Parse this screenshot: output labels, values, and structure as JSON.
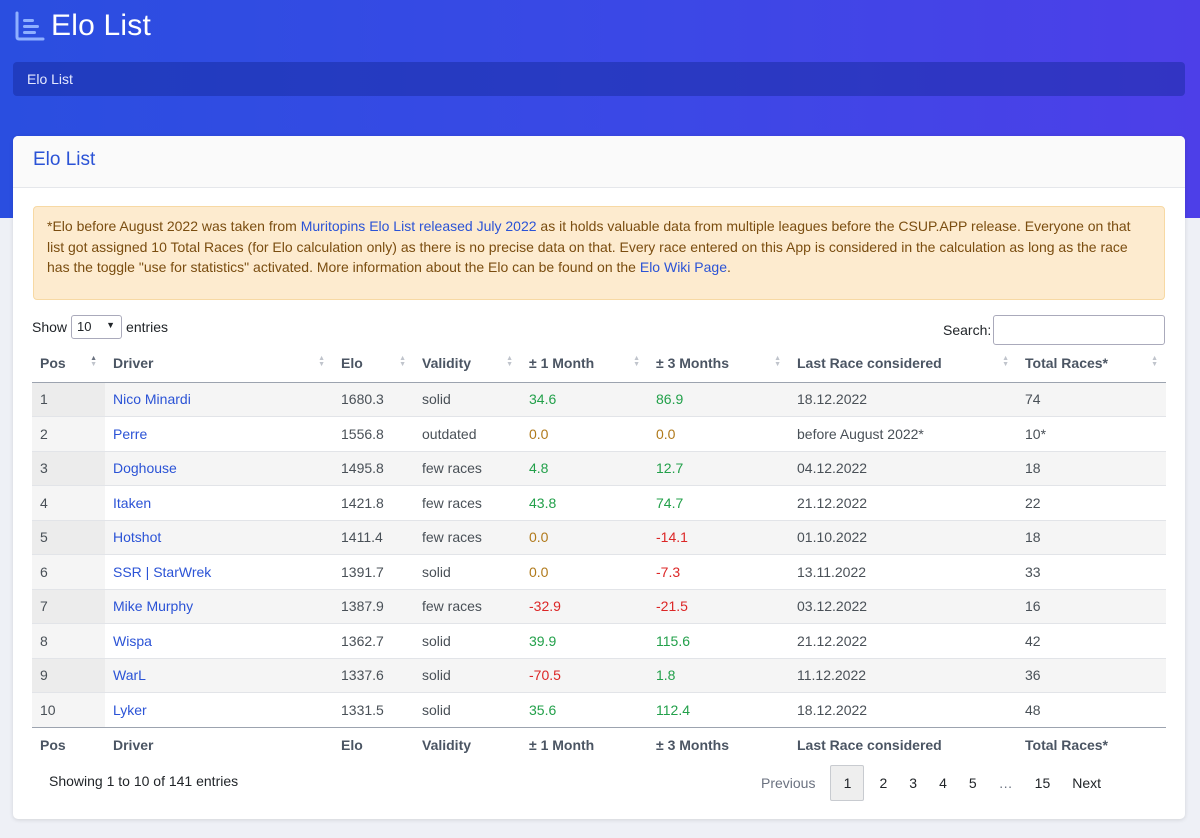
{
  "app": {
    "title": "Elo List",
    "breadcrumb": "Elo List"
  },
  "card": {
    "title": "Elo List"
  },
  "notice": {
    "text_1": "*Elo before August 2022 was taken from ",
    "link_1": "Muritopins Elo List released July 2022",
    "text_2": " as it holds valuable data from multiple leagues before the CSUP.APP release. Everyone on that list got assigned 10 Total Races (for Elo calculation only) as there is no precise data on that. Every race entered on this App is considered in the calculation as long as the race has the toggle \"use for statistics\" activated. More information about the Elo can be found on the ",
    "link_2": "Elo Wiki Page",
    "text_3": "."
  },
  "length_control": {
    "show_label": "Show",
    "value": "10",
    "entries_label": "entries"
  },
  "search": {
    "label": "Search:",
    "value": ""
  },
  "table": {
    "columns": [
      "Pos",
      "Driver",
      "Elo",
      "Validity",
      "± 1 Month",
      "± 3 Months",
      "Last Race considered",
      "Total Races*"
    ],
    "rows": [
      [
        "1",
        "Nico Minardi",
        "1680.3",
        "solid",
        "34.6",
        "86.9",
        "18.12.2022",
        "74"
      ],
      [
        "2",
        "Perre",
        "1556.8",
        "outdated",
        "0.0",
        "0.0",
        "before August 2022*",
        "10*"
      ],
      [
        "3",
        "Doghouse",
        "1495.8",
        "few races",
        "4.8",
        "12.7",
        "04.12.2022",
        "18"
      ],
      [
        "4",
        "Itaken",
        "1421.8",
        "few races",
        "43.8",
        "74.7",
        "21.12.2022",
        "22"
      ],
      [
        "5",
        "Hotshot",
        "1411.4",
        "few races",
        "0.0",
        "-14.1",
        "01.10.2022",
        "18"
      ],
      [
        "6",
        "SSR | StarWrek",
        "1391.7",
        "solid",
        "0.0",
        "-7.3",
        "13.11.2022",
        "33"
      ],
      [
        "7",
        "Mike Murphy",
        "1387.9",
        "few races",
        "-32.9",
        "-21.5",
        "03.12.2022",
        "16"
      ],
      [
        "8",
        "Wispa",
        "1362.7",
        "solid",
        "39.9",
        "115.6",
        "21.12.2022",
        "42"
      ],
      [
        "9",
        "WarL",
        "1337.6",
        "solid",
        "-70.5",
        "1.8",
        "11.12.2022",
        "36"
      ],
      [
        "10",
        "Lyker",
        "1331.5",
        "solid",
        "35.6",
        "112.4",
        "18.12.2022",
        "48"
      ]
    ]
  },
  "info": "Showing 1 to 10 of 141 entries",
  "pagination": {
    "previous": "Previous",
    "pages": [
      "1",
      "2",
      "3",
      "4",
      "5",
      "…",
      "15"
    ],
    "current": "1",
    "next": "Next"
  },
  "colors": {
    "accent": "#2b53d6",
    "positive": "#22a04a",
    "negative": "#dc2626",
    "neutral": "#b0791a",
    "alert_bg": "#fdebcf"
  }
}
